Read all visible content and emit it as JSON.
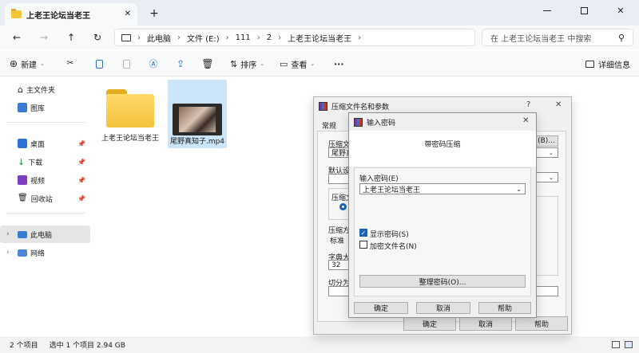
{
  "window": {
    "tab_title": "上老王论坛当老王",
    "new_tab": "+",
    "close_tab": "✕"
  },
  "nav": {
    "breadcrumb": [
      "此电脑",
      "文件 (E:)",
      "111",
      "2",
      "上老王论坛当老王"
    ],
    "search_placeholder": "在 上老王论坛当老王 中搜索"
  },
  "toolbar": {
    "new_label": "新建",
    "sort_label": "排序",
    "view_label": "查看",
    "more_label": "···",
    "details_label": "详细信息"
  },
  "sidebar": {
    "items": [
      {
        "label": "主文件夹",
        "icon": "home-icon"
      },
      {
        "label": "图库",
        "icon": "gallery-icon"
      },
      {
        "label": "桌面",
        "icon": "desktop-icon"
      },
      {
        "label": "下载",
        "icon": "download-icon"
      },
      {
        "label": "视频",
        "icon": "video-icon"
      },
      {
        "label": "回收站",
        "icon": "recycle-bin-icon"
      },
      {
        "label": "此电脑",
        "icon": "this-pc-icon",
        "selected": true
      },
      {
        "label": "网络",
        "icon": "network-icon"
      }
    ]
  },
  "files": [
    {
      "name": "上老王论坛当老王",
      "type": "folder"
    },
    {
      "name": "尾野真知子.mp4",
      "type": "video",
      "selected": true
    }
  ],
  "status": {
    "item_count": "2 个项目",
    "selection": "选中 1 个项目  2.94 GB"
  },
  "archive_dialog": {
    "title": "压缩文件名和参数",
    "help": "?",
    "close": "✕",
    "tab_general": "常规",
    "archive_name_label": "压缩文件",
    "archive_name_value": "尾野真",
    "browse_label": "(B)...",
    "default_settings_label": "默认设置",
    "format_label": "压缩文",
    "method_label": "压缩方",
    "method_value": "标准",
    "dict_label": "字典大小",
    "dict_value": "32",
    "split_label": "切分为分",
    "ok": "确定",
    "cancel": "取消",
    "help_btn": "帮助"
  },
  "password_dialog": {
    "title": "输入密码",
    "close": "✕",
    "heading": "带密码压缩",
    "enter_label": "输入密码(E)",
    "password_value": "上老王论坛当老王",
    "show_password": "显示密码(S)",
    "show_password_checked": true,
    "encrypt_names": "加密文件名(N)",
    "encrypt_names_checked": false,
    "organize_btn": "整理密码(O)...",
    "ok": "确定",
    "cancel": "取消",
    "help": "帮助"
  },
  "colors": {
    "accent": "#1a64b8",
    "folder": "#f3c63a",
    "selection": "#cce4f7"
  }
}
